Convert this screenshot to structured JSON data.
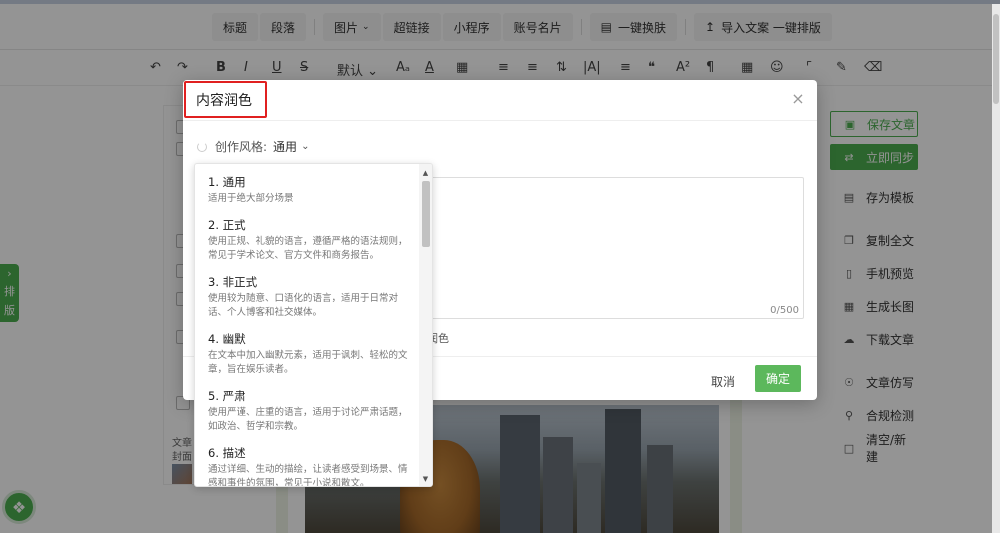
{
  "topmenu": {
    "items": [
      "标题",
      "段落",
      "图片",
      "超链接",
      "小程序",
      "账号名片"
    ],
    "theme_button": "一键换肤",
    "import_button": "导入文案 一键排版"
  },
  "toolbar": {
    "font_size": "默认"
  },
  "side_tab": {
    "chars": [
      "排",
      "版"
    ]
  },
  "left_panel": {
    "cover_label_1": "文章",
    "cover_label_2": "封面"
  },
  "right_panel": {
    "buttons": [
      "保存文章",
      "立即同步",
      "存为模板",
      "复制全文",
      "手机预览",
      "生成长图",
      "下载文章",
      "文章仿写",
      "合规检测",
      "清空/新建"
    ]
  },
  "modal": {
    "title": "内容润色",
    "style_label": "创作风格:",
    "style_value": "通用",
    "char_count": "0/500",
    "polish_label": "润色",
    "cancel": "取消",
    "ok": "确定"
  },
  "dropdown": {
    "options": [
      {
        "name": "1. 通用",
        "desc": "适用于绝大部分场景"
      },
      {
        "name": "2. 正式",
        "desc": "使用正规、礼貌的语言，遵循严格的语法规则，常见于学术论文、官方文件和商务报告。"
      },
      {
        "name": "3. 非正式",
        "desc": "使用较为随意、口语化的语言，适用于日常对话、个人博客和社交媒体。"
      },
      {
        "name": "4. 幽默",
        "desc": "在文本中加入幽默元素，适用于讽刺、轻松的文章，旨在娱乐读者。"
      },
      {
        "name": "5. 严肃",
        "desc": "使用严谨、庄重的语言，适用于讨论严肃话题，如政治、哲学和宗教。"
      },
      {
        "name": "6. 描述",
        "desc": "通过详细、生动的描绘，让读者感受到场景、情感和事件的氛围，常见于小说和散文。"
      }
    ]
  },
  "colors": {
    "accent_green": "#4caf50",
    "highlight_red": "#e02020"
  }
}
